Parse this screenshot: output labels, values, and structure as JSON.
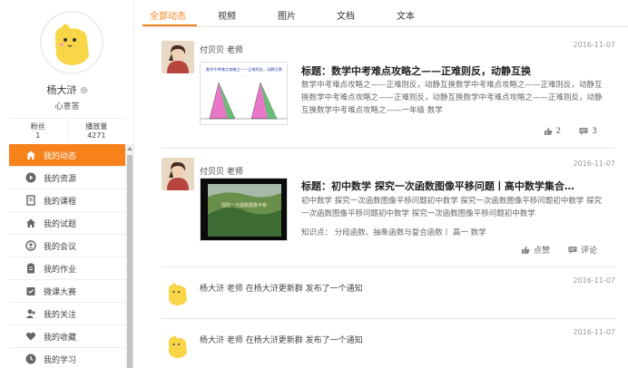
{
  "profile": {
    "name": "杨大浒",
    "tagline": "心意答",
    "fans_label": "粉丝",
    "fans_value": "1",
    "plays_label": "播放量",
    "plays_value": "4271"
  },
  "menu": [
    {
      "label": "我的动态",
      "icon": "home-icon",
      "active": true
    },
    {
      "label": "我的资源",
      "icon": "play-circle-icon"
    },
    {
      "label": "我的课程",
      "icon": "book-icon"
    },
    {
      "label": "我的试题",
      "icon": "home-icon"
    },
    {
      "label": "我的会议",
      "icon": "meeting-icon"
    },
    {
      "label": "我的作业",
      "icon": "clipboard-icon"
    },
    {
      "label": "微课大赛",
      "icon": "badge-check-icon"
    },
    {
      "label": "我的关注",
      "icon": "user-follow-icon"
    },
    {
      "label": "我的收藏",
      "icon": "heart-icon"
    },
    {
      "label": "我的学习",
      "icon": "clock-icon"
    }
  ],
  "tabs": [
    "全部动态",
    "视频",
    "图片",
    "文档",
    "文本"
  ],
  "posts": [
    {
      "author": "付贝贝 老师",
      "date": "2016-11-07",
      "title": "标题：数学中考难点攻略之——正难则反，动静互换",
      "desc": "数学中考难点攻略之——正难则反，动静互换数学中考难点攻略之——正难则反，动静互换数学中考难点攻略之——正难则反，动静互换数学中考难点攻略之——正难则反，动静互换数学中考难点攻略之——一年级 数学",
      "likes": "2",
      "comments": "3",
      "thumb_title": "数学中考难点攻略之——正难则反，动静互换"
    },
    {
      "author": "付贝贝 老师",
      "date": "2016-11-07",
      "title": "标题：初中数学 探究一次函数图像平移问题丨高中数学集合…",
      "desc": "初中数学 探究一次函数图像平移问题初中数学 探究一次函数图像平移问题初中数学 探究一次函数图像平移问题初中数学 探究一次函数图像平移问题初中数学",
      "knowledge": "知识点：  分段函数、抽象函数与复合函数丨 高一 数学",
      "like_label": "点赞",
      "comment_label": "评论",
      "thumb_title": "探究一次函数图像平移"
    }
  ],
  "notices": [
    {
      "text": "杨大浒 老师 在杨大浒更新群 发布了一个通知",
      "date": "2016-11-07"
    },
    {
      "text": "杨大浒 老师 在杨大浒更新群 发布了一个通知",
      "date": "2016-11-07"
    }
  ],
  "colors": {
    "accent": "#f7821b",
    "avatar_yellow": "#f9d548"
  }
}
